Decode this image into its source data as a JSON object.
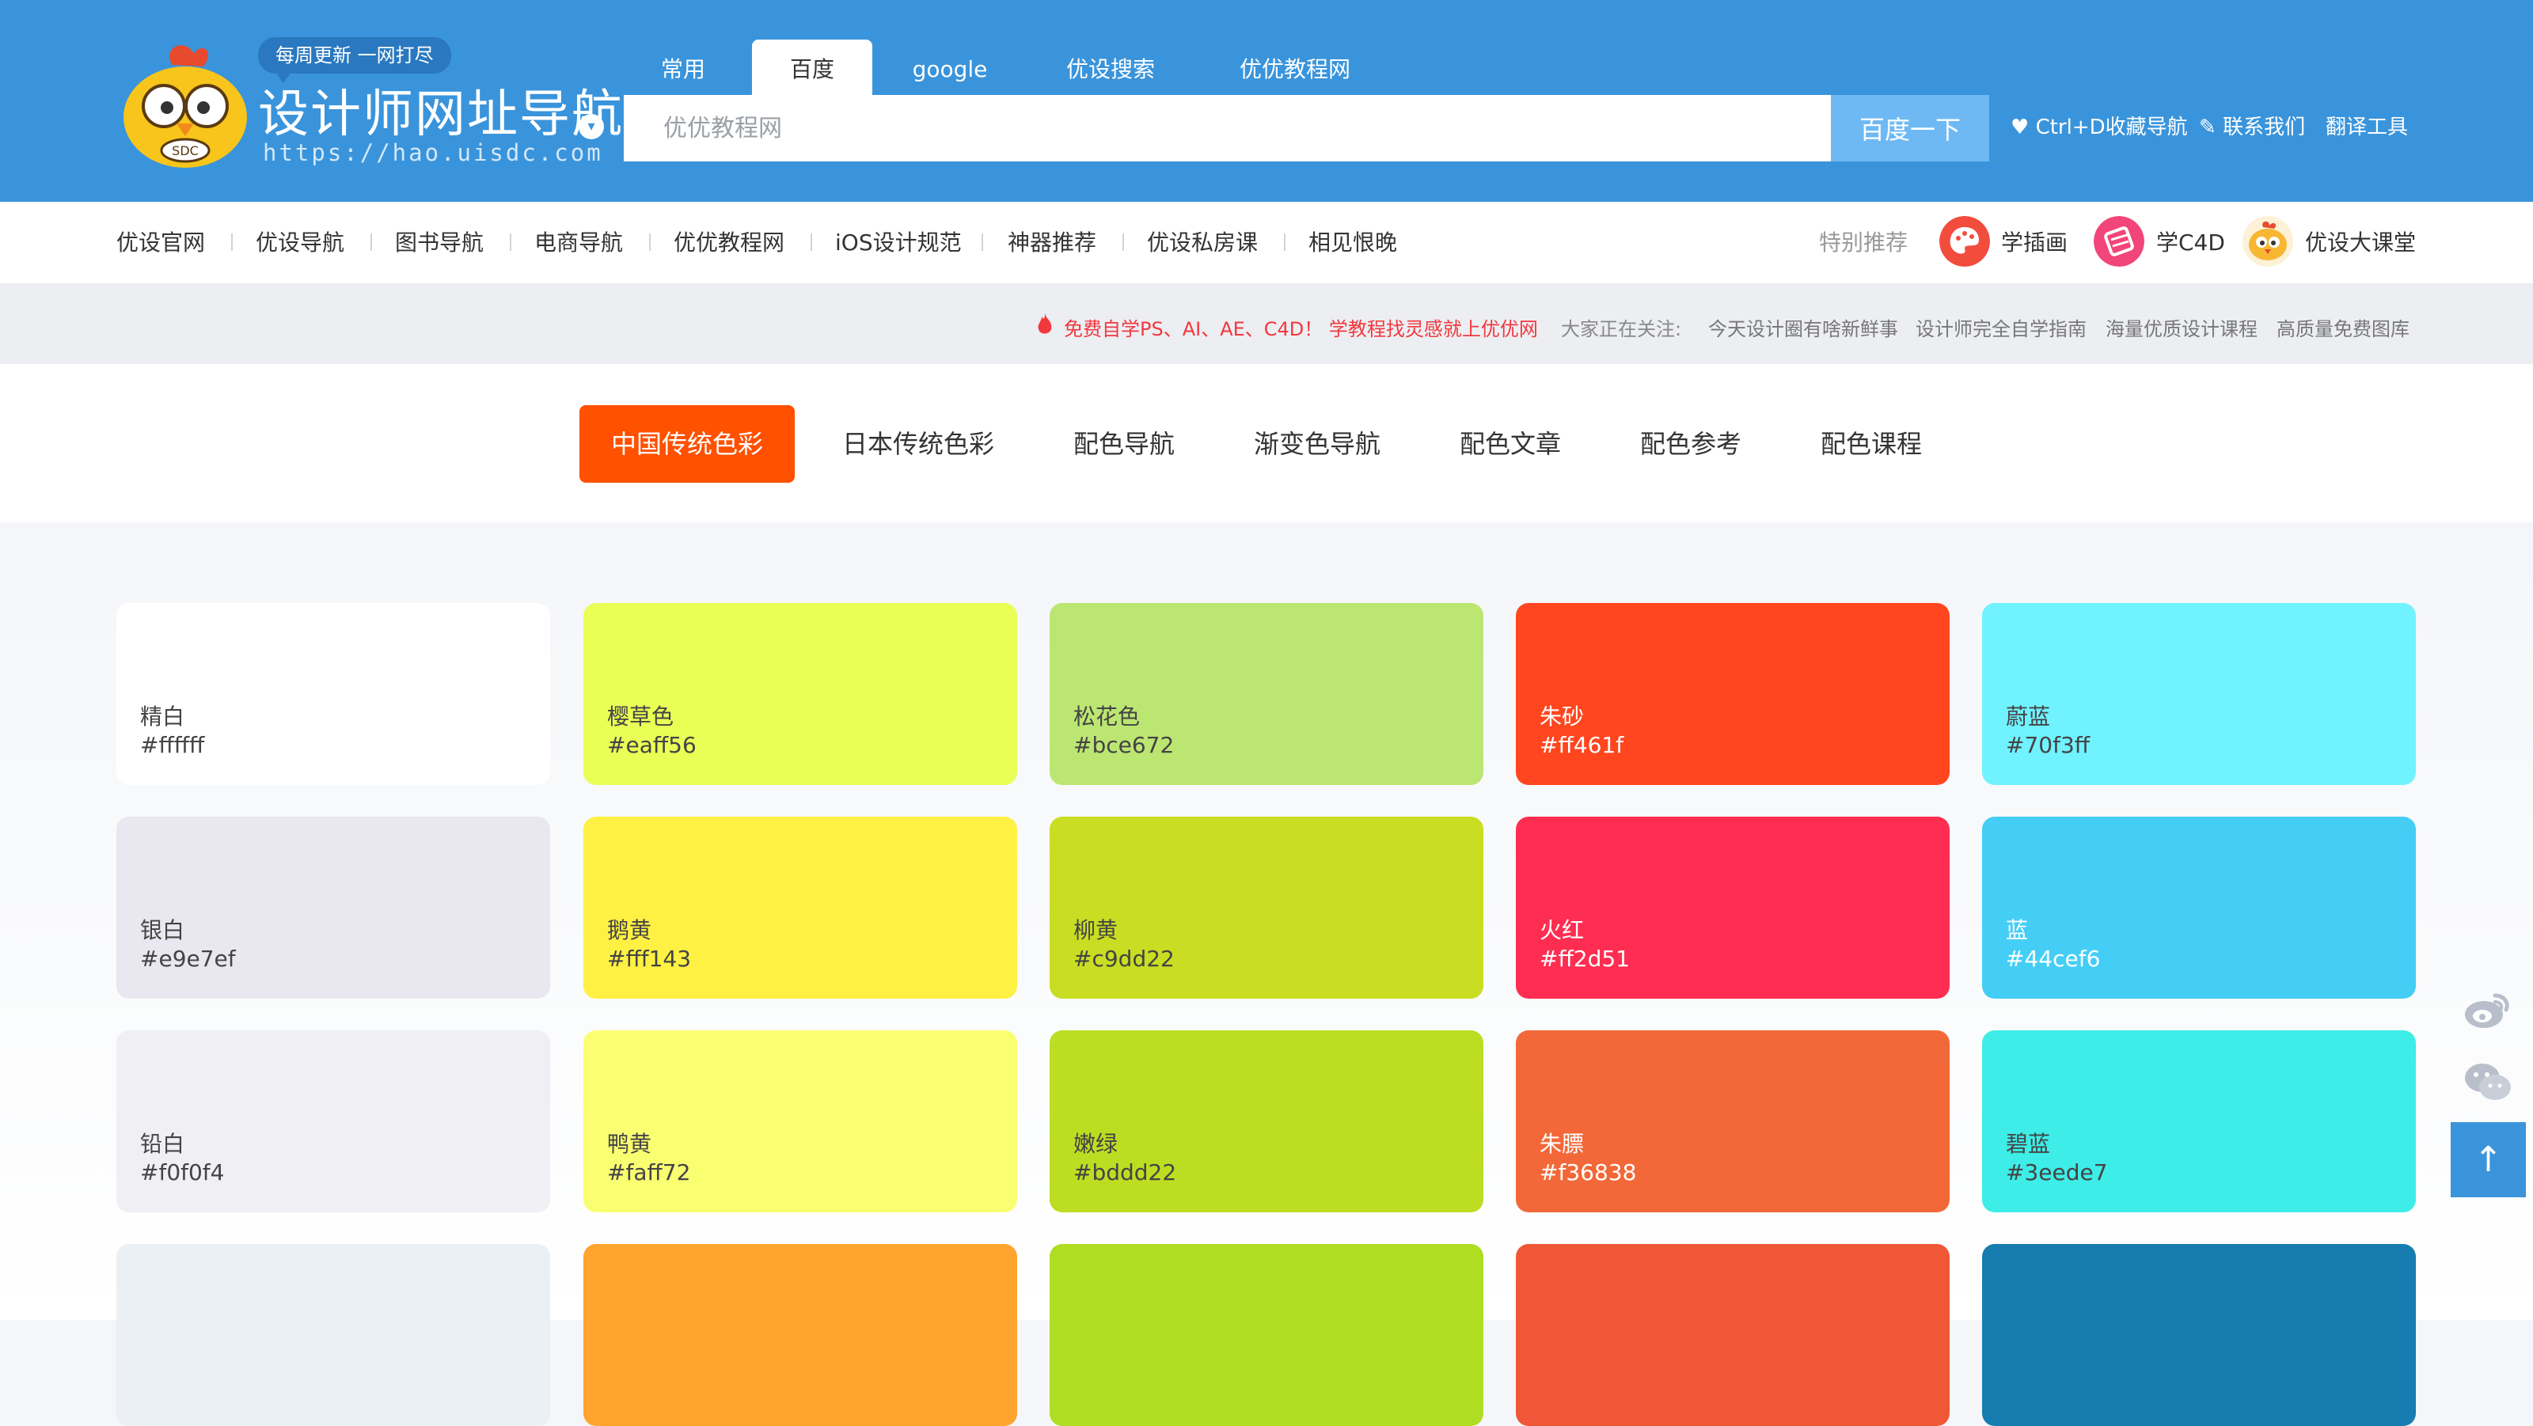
{
  "header": {
    "slogan": "每周更新 一网打尽",
    "title": "设计师网址导航",
    "url": "https://hao.uisdc.com",
    "dropdown_glyph": "▾",
    "search_tabs": [
      "常用",
      "百度",
      "google",
      "优设搜索",
      "优优教程网"
    ],
    "active_search_tab": "百度",
    "search_placeholder": "优优教程网",
    "search_button": "百度一下",
    "links": [
      "Ctrl+D收藏导航",
      "联系我们",
      "翻译工具"
    ],
    "link_icons": [
      "heart-icon",
      "pencil-icon",
      ""
    ]
  },
  "nav": {
    "items": [
      "优设官网",
      "优设导航",
      "图书导航",
      "电商导航",
      "优优教程网",
      "iOS设计规范",
      "神器推荐",
      "优设私房课",
      "相见恨晚"
    ],
    "recommend_label": "特别推荐",
    "recommend": [
      {
        "label": "学插画",
        "icon": "palette-icon",
        "color": "#f24c3d"
      },
      {
        "label": "学C4D",
        "icon": "film-icon",
        "color": "#f2457a"
      },
      {
        "label": "优设大课堂",
        "icon": "mascot-icon",
        "color": "#f7b733"
      }
    ]
  },
  "notice": {
    "promo": "免费自学PS、AI、AE、C4D！ 学教程找灵感就上优优网",
    "promo_color": "#f2383d",
    "focus_label": "大家正在关注:",
    "focus_items": [
      "今天设计圈有啥新鲜事",
      "设计师完全自学指南",
      "海量优质设计课程",
      "高质量免费图库"
    ]
  },
  "color_tabs": [
    "中国传统色彩",
    "日本传统色彩",
    "配色导航",
    "渐变色导航",
    "配色文章",
    "配色参考",
    "配色课程"
  ],
  "active_color_tab": "中国传统色彩",
  "accent": "#ff5100",
  "colors": [
    {
      "name": "精白",
      "hex": "#ffffff"
    },
    {
      "name": "樱草色",
      "hex": "#eaff56"
    },
    {
      "name": "松花色",
      "hex": "#bce672"
    },
    {
      "name": "朱砂",
      "hex": "#ff461f"
    },
    {
      "name": "蔚蓝",
      "hex": "#70f3ff"
    },
    {
      "name": "银白",
      "hex": "#e9e7ef"
    },
    {
      "name": "鹅黄",
      "hex": "#fff143"
    },
    {
      "name": "柳黄",
      "hex": "#c9dd22"
    },
    {
      "name": "火红",
      "hex": "#ff2d51"
    },
    {
      "name": "蓝",
      "hex": "#44cef6"
    },
    {
      "name": "铅白",
      "hex": "#f0f0f4"
    },
    {
      "name": "鸭黄",
      "hex": "#faff72"
    },
    {
      "name": "嫩绿",
      "hex": "#bddd22"
    },
    {
      "name": "朱膘",
      "hex": "#f36838"
    },
    {
      "name": "碧蓝",
      "hex": "#3eede7"
    }
  ],
  "partial_row_colors": [
    "#ebf0f4",
    "#ffa42e",
    "#afdd22",
    "#ef5737",
    "#177cb0"
  ],
  "side_tools": [
    "weibo-icon",
    "wechat-icon"
  ],
  "back_to_top": "↑"
}
